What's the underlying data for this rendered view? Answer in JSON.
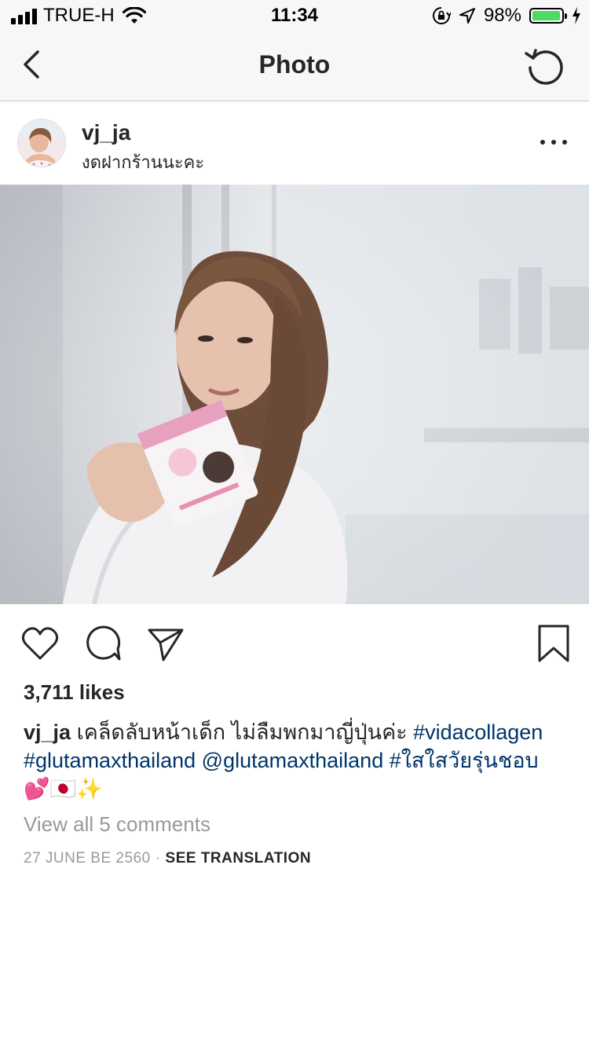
{
  "status_bar": {
    "carrier": "TRUE-H",
    "time": "11:34",
    "battery_percent": "98%",
    "battery_level": 0.98
  },
  "nav": {
    "title": "Photo"
  },
  "post": {
    "username": "vj_ja",
    "location": "งดฝากร้านนะคะ",
    "likes": "3,711 likes",
    "caption": {
      "username": "vj_ja",
      "text": "เคล็ดลับหน้าเด็ก ไม่ลืมพกมาญี่ปุ่นค่ะ ",
      "tag1": "#vidacollagen",
      "tag2": "#glutamaxthailand",
      "mention": "@glutamaxthailand",
      "tag3": "#ใสใสวัยรุ่นชอบ",
      "emojis": "💕🇯🇵✨"
    },
    "view_comments": "View all 5 comments",
    "date": "27 JUNE BE 2560",
    "see_translation": "SEE TRANSLATION"
  },
  "colors": {
    "link": "#003569",
    "secondary_text": "#999999",
    "primary_text": "#262626",
    "battery_green": "#4cd964"
  }
}
